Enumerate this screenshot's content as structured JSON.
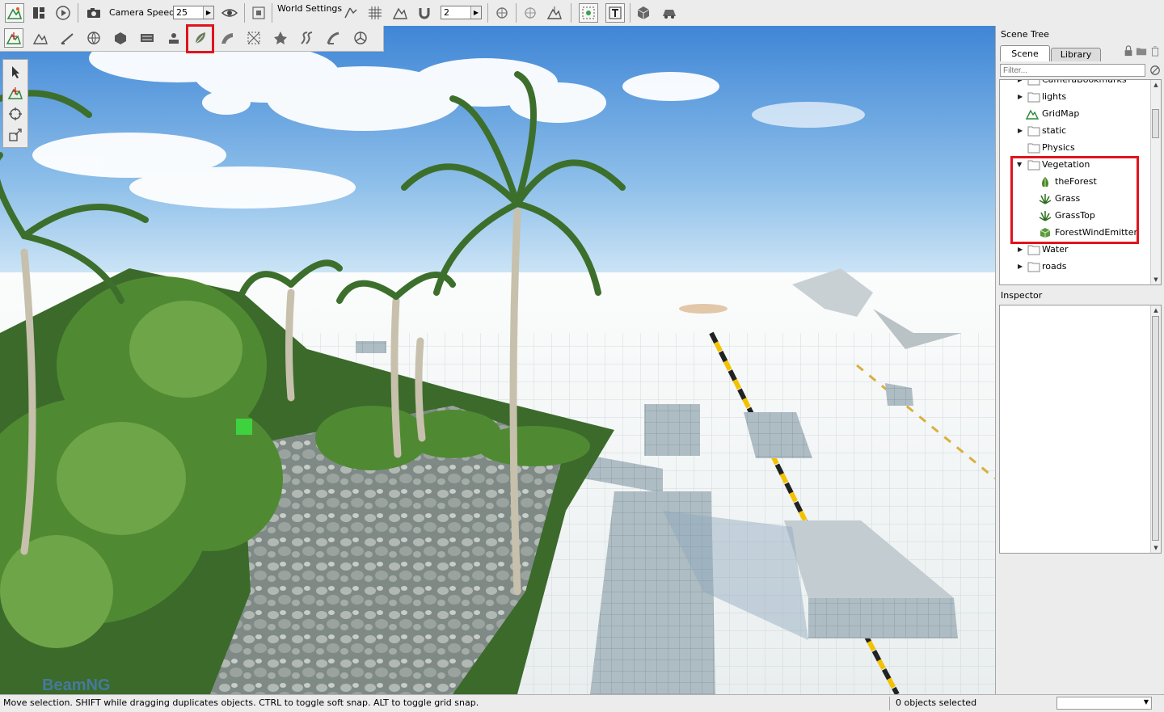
{
  "toolbar": {
    "camera_speed_label": "Camera Speed",
    "camera_speed_value": "25",
    "world_settings_label": "World Settings",
    "grid_value": "2"
  },
  "scene_tree": {
    "title": "Scene Tree",
    "tabs": [
      {
        "label": "Scene",
        "active": true
      },
      {
        "label": "Library",
        "active": false
      }
    ],
    "filter_placeholder": "Filter...",
    "items": [
      {
        "label": "CameraBookmarks",
        "indent": 0,
        "expandable": true,
        "icon": "folder-icon"
      },
      {
        "label": "lights",
        "indent": 0,
        "expandable": true,
        "icon": "folder-icon"
      },
      {
        "label": "GridMap",
        "indent": 0,
        "expandable": false,
        "icon": "terrain-icon"
      },
      {
        "label": "static",
        "indent": 0,
        "expandable": true,
        "icon": "folder-icon"
      },
      {
        "label": "Physics",
        "indent": 0,
        "expandable": false,
        "icon": "folder-icon"
      },
      {
        "label": "Vegetation",
        "indent": 0,
        "expandable": true,
        "expanded": true,
        "icon": "folder-icon"
      },
      {
        "label": "theForest",
        "indent": 1,
        "expandable": false,
        "icon": "forest-icon"
      },
      {
        "label": "Grass",
        "indent": 1,
        "expandable": false,
        "icon": "grass-icon"
      },
      {
        "label": "GrassTop",
        "indent": 1,
        "expandable": false,
        "icon": "grass-icon"
      },
      {
        "label": "ForestWindEmitter",
        "indent": 1,
        "expandable": false,
        "icon": "wind-emitter-icon"
      },
      {
        "label": "Water",
        "indent": 0,
        "expandable": true,
        "icon": "folder-icon"
      },
      {
        "label": "roads",
        "indent": 0,
        "expandable": true,
        "icon": "folder-icon"
      }
    ]
  },
  "inspector": {
    "title": "Inspector"
  },
  "status": {
    "message": "Move selection.  SHIFT while dragging duplicates objects.  CTRL to toggle soft snap.  ALT to toggle grid snap.",
    "selection_count": "0 objects selected"
  },
  "viewport": {
    "watermark": "BeamNG"
  },
  "colors": {
    "highlight": "#e0141e",
    "sky_top": "#3f86d6",
    "sky_bottom": "#bfdcf2",
    "ground": "#f4f6f6"
  }
}
